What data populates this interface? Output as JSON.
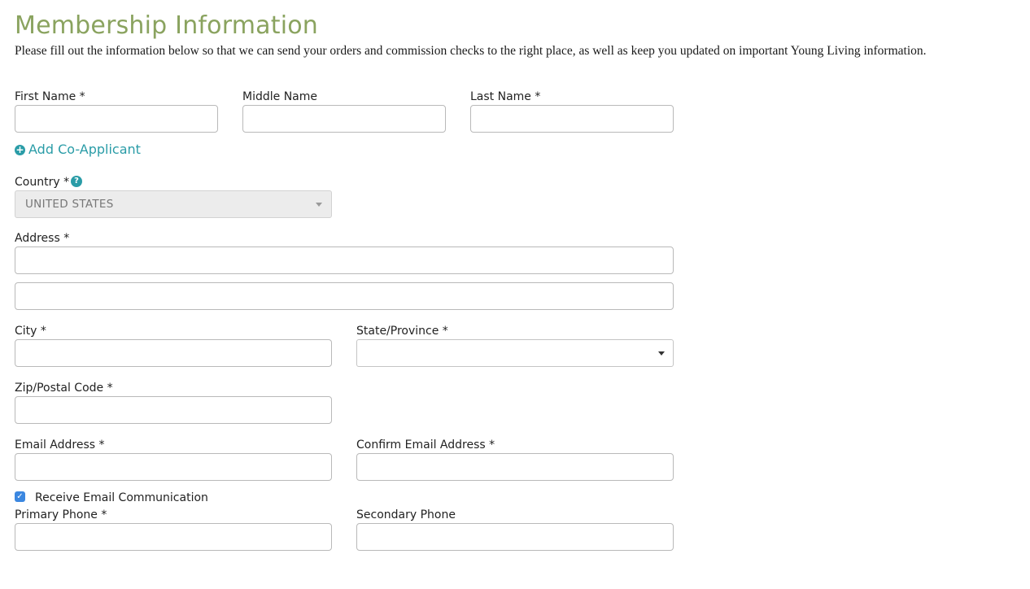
{
  "page": {
    "title": "Membership Information",
    "intro": "Please fill out the information below so that we can send your orders and commission checks to the right place, as well as keep you updated on important Young Living information."
  },
  "fields": {
    "first_name": {
      "label": "First Name *",
      "value": ""
    },
    "middle_name": {
      "label": "Middle Name",
      "value": ""
    },
    "last_name": {
      "label": "Last Name *",
      "value": ""
    },
    "add_co_applicant": "Add Co-Applicant",
    "country": {
      "label": "Country *",
      "value": "UNITED STATES",
      "help_icon": "question-circle-icon"
    },
    "address": {
      "label": "Address *",
      "line1": "",
      "line2": ""
    },
    "city": {
      "label": "City *",
      "value": ""
    },
    "state": {
      "label": "State/Province *",
      "value": ""
    },
    "zip": {
      "label": "Zip/Postal Code *",
      "value": ""
    },
    "email": {
      "label": "Email Address *",
      "value": ""
    },
    "confirm_email": {
      "label": "Confirm Email Address *",
      "value": ""
    },
    "receive_email": {
      "label": "Receive Email Communication",
      "checked": true
    },
    "primary_phone": {
      "label": "Primary Phone *",
      "value": ""
    },
    "secondary_phone": {
      "label": "Secondary Phone",
      "value": ""
    }
  },
  "colors": {
    "title": "#8aa35f",
    "link": "#2a9ca7",
    "checkbox": "#3b87e0",
    "input_border": "#b9b9b9",
    "disabled_bg": "#ececec"
  }
}
